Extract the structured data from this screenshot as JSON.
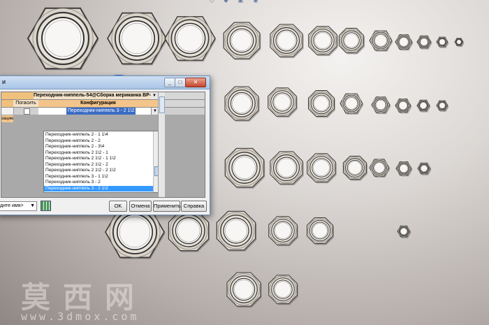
{
  "dialog": {
    "title": "и",
    "header_caption": "Переходник-ниппель-54@Сборка мериканка ВР-ВР",
    "col_hide": "Погасить",
    "col_config": "Конфигурация",
    "selected_config": "Переходник-ниппель 3 - 2 1\\2",
    "row_label": "зацию >",
    "config_options": [
      "Переходник-ниппель 2 - 1 1\\4",
      "Переходник-ниппель 2 - 2",
      "Переходник-ниппель 2 - 3\\4",
      "Переходник-ниппель 2 1\\2 - 1",
      "Переходник-ниппель 2 1\\2 - 1 1\\2",
      "Переходник-ниппель 2 1\\2 - 2",
      "Переходник-ниппель 2 1\\2 - 2 1\\2",
      "Переходник-ниппель 3 - 1 1\\2",
      "Переходник-ниппель 3 - 2",
      "Переходник-ниппель 3 - 2 1\\2"
    ],
    "selected_index": 9,
    "name_combo": "дите имя>",
    "ok": "OK",
    "cancel": "Отмена",
    "apply": "Применить",
    "help": "Справка"
  },
  "watermark": {
    "brand": "莫西网",
    "url": "www.3dmox.com"
  },
  "toolbar_icons": "◇ ◆ ▣ ◉",
  "colors": {
    "nut_face": "#d9d3c9",
    "nut_edge": "#3a3a3a",
    "selection": "#3399ff",
    "highlight_ring": "#2a6fd6"
  }
}
